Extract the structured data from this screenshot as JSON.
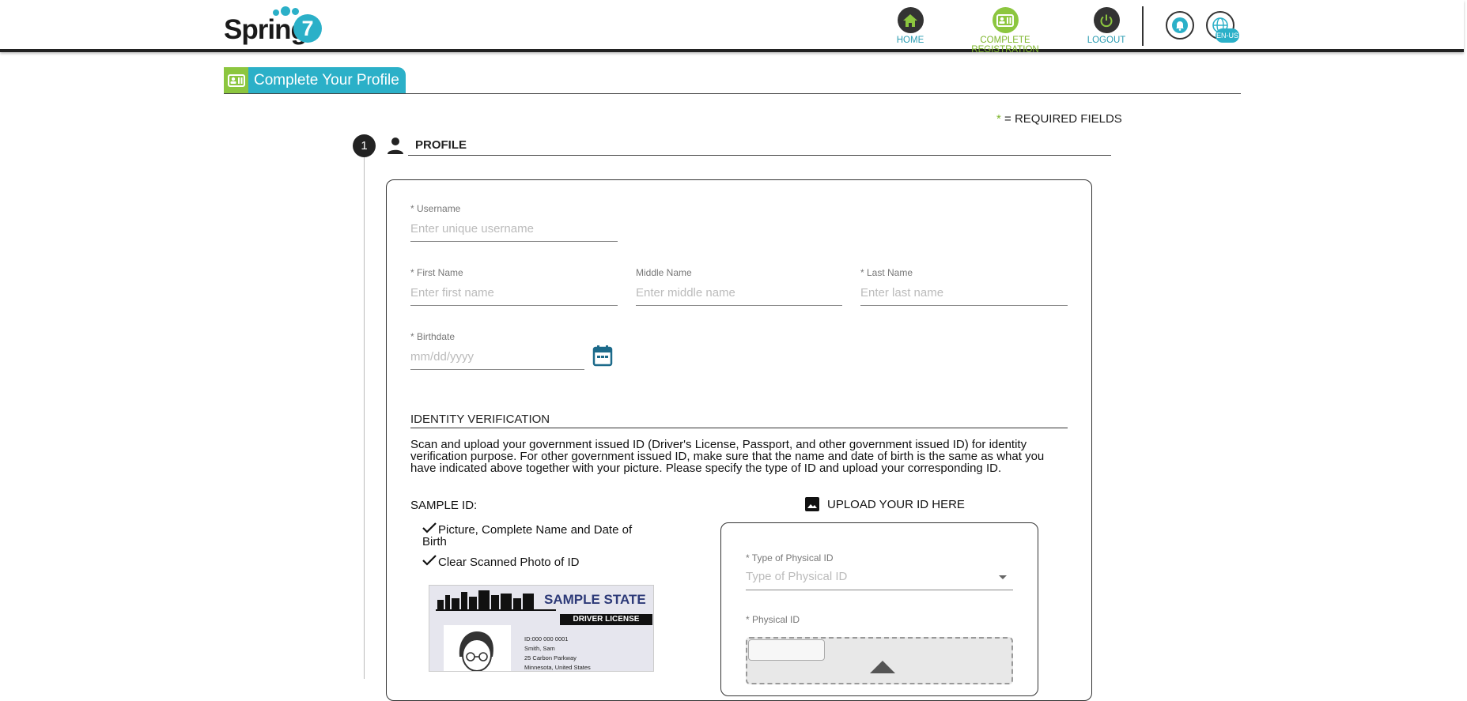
{
  "header": {
    "logo_text": "Spring",
    "logo_number": "7",
    "nav": {
      "home": "HOME",
      "complete_registration": "COMPLETE REGISTRATION",
      "logout": "LOGOUT"
    },
    "language": "EN-US"
  },
  "page": {
    "title": "Complete Your Profile",
    "required_star": "*",
    "required_note": "= REQUIRED FIELDS"
  },
  "step": {
    "number": "1",
    "label": "PROFILE"
  },
  "form": {
    "username": {
      "label": "* Username",
      "placeholder": "Enter unique username",
      "value": ""
    },
    "first_name": {
      "label": "* First Name",
      "placeholder": "Enter first name",
      "value": ""
    },
    "middle_name": {
      "label": "Middle Name",
      "placeholder": "Enter middle name",
      "value": ""
    },
    "last_name": {
      "label": "* Last Name",
      "placeholder": "Enter last name",
      "value": ""
    },
    "birthdate": {
      "label": "* Birthdate",
      "placeholder": "mm/dd/yyyy",
      "value": ""
    }
  },
  "identity": {
    "heading": "IDENTITY VERIFICATION",
    "description": "Scan and upload your government issued ID (Driver's License, Passport, and other government issued ID) for identity verification purpose. For other government issued ID, make sure that the name and date of birth is the same as what you have indicated above together with your picture. Please specify the type of ID and upload your corresponding ID.",
    "sample_heading": "SAMPLE ID:",
    "checks": [
      "Picture, Complete Name and Date of Birth",
      "Clear Scanned Photo of ID"
    ],
    "sample_card": {
      "state": "SAMPLE STATE",
      "band": "DRIVER LICENSE",
      "id_line": "ID:000 000 0001",
      "name_line": "Smith, Sam",
      "address_line1": "25 Carbon Parkway",
      "address_line2": "Minnesota, United States"
    },
    "upload_heading": "UPLOAD YOUR ID HERE",
    "type_label": "* Type of Physical ID",
    "type_placeholder": "Type of Physical ID",
    "physical_id_label": "* Physical ID"
  },
  "colors": {
    "accent_teal": "#2bb0c8",
    "accent_green": "#8cc63f",
    "dark": "#222222"
  }
}
